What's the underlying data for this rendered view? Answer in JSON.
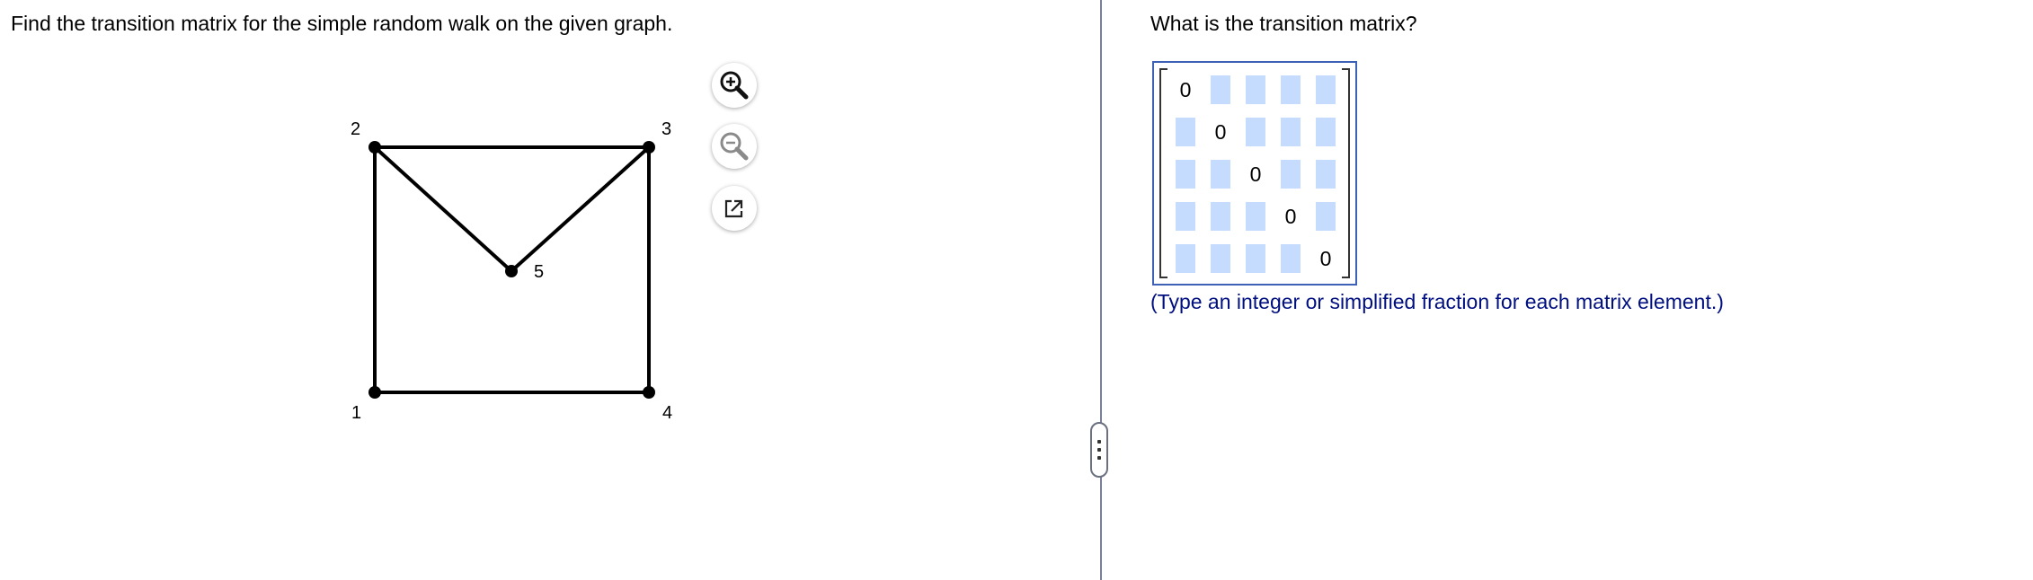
{
  "question": {
    "text": "Find the transition matrix for the simple random walk on the given graph."
  },
  "graph": {
    "nodes": [
      {
        "id": "1",
        "label": "1"
      },
      {
        "id": "2",
        "label": "2"
      },
      {
        "id": "3",
        "label": "3"
      },
      {
        "id": "4",
        "label": "4"
      },
      {
        "id": "5",
        "label": "5"
      }
    ],
    "edges": [
      [
        "1",
        "2"
      ],
      [
        "2",
        "3"
      ],
      [
        "3",
        "4"
      ],
      [
        "4",
        "1"
      ],
      [
        "2",
        "5"
      ],
      [
        "3",
        "5"
      ]
    ]
  },
  "tools": {
    "zoom_in_icon": "zoom-in-icon",
    "zoom_out_icon": "zoom-out-icon",
    "popout_icon": "external-link-icon"
  },
  "answer": {
    "prompt": "What is the transition matrix?",
    "matrix": [
      [
        "0",
        "",
        "",
        "",
        ""
      ],
      [
        "",
        "0",
        "",
        "",
        ""
      ],
      [
        "",
        "",
        "0",
        "",
        ""
      ],
      [
        "",
        "",
        "",
        "0",
        ""
      ],
      [
        "",
        "",
        "",
        "",
        "0"
      ]
    ],
    "instruction": "(Type an integer or simplified fraction for each matrix element.)"
  },
  "colors": {
    "input_cell": "#c6dcff",
    "matrix_border": "#3d62b5",
    "instruction_text": "#000f80",
    "divider": "#7a7f9a"
  }
}
